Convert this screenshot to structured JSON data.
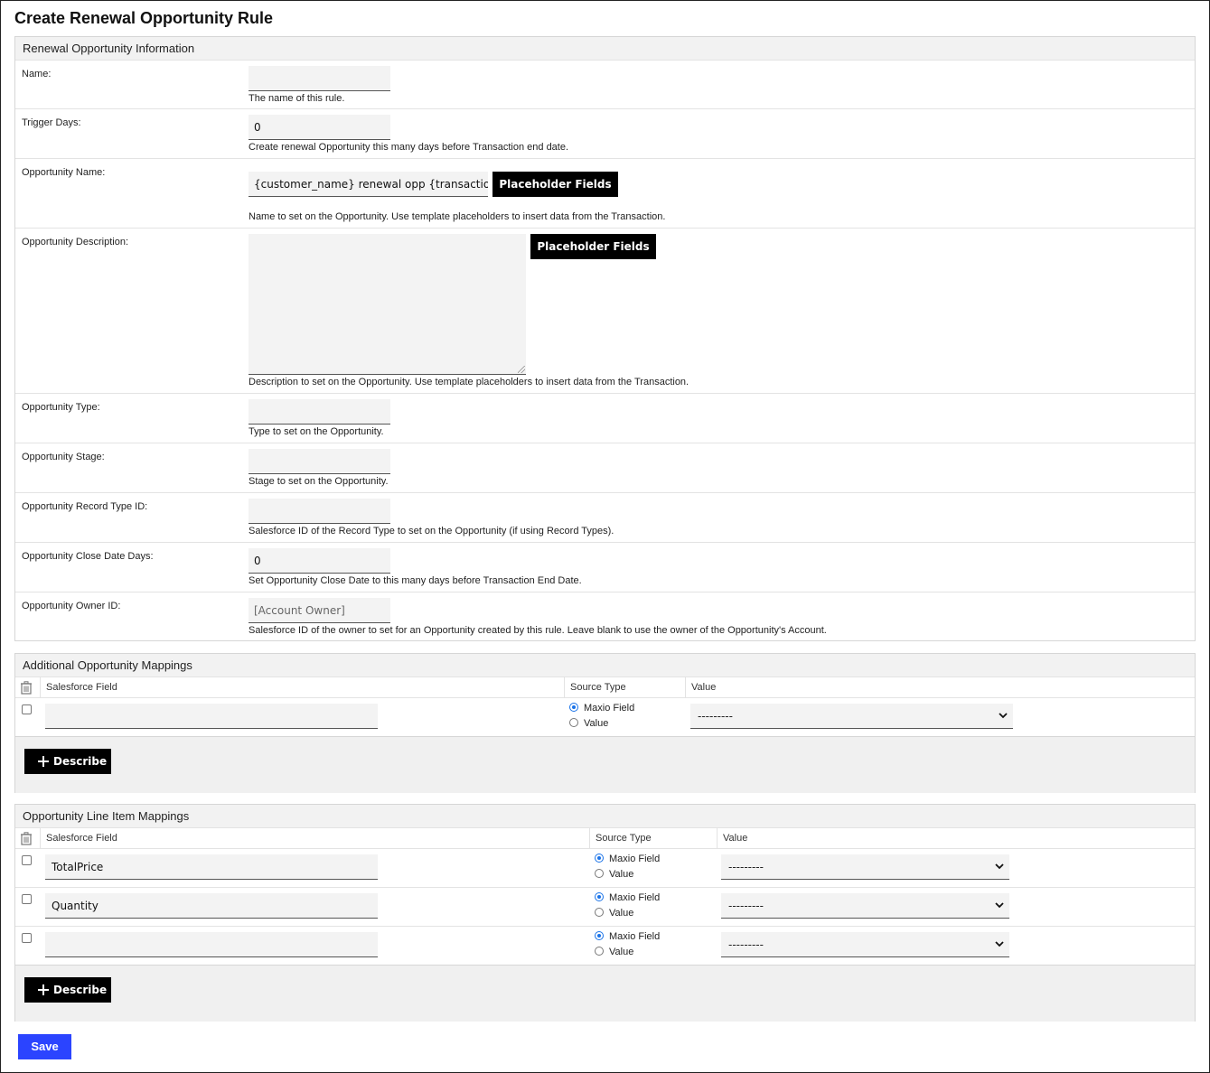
{
  "page": {
    "title": "Create Renewal Opportunity Rule"
  },
  "info": {
    "heading": "Renewal Opportunity Information",
    "fields": {
      "name": {
        "label": "Name:",
        "value": "",
        "help": "The name of this rule."
      },
      "trigger_days": {
        "label": "Trigger Days:",
        "value": "0",
        "help": "Create renewal Opportunity this many days before Transaction end date."
      },
      "opp_name": {
        "label": "Opportunity Name:",
        "value": "{customer_name} renewal opp {transaction",
        "button": "Placeholder Fields",
        "help": "Name to set on the Opportunity. Use template placeholders to insert data from the Transaction."
      },
      "opp_desc": {
        "label": "Opportunity Description:",
        "value": "",
        "button": "Placeholder Fields",
        "help": "Description to set on the Opportunity. Use template placeholders to insert data from the Transaction."
      },
      "opp_type": {
        "label": "Opportunity Type:",
        "value": "",
        "help": "Type to set on the Opportunity."
      },
      "opp_stage": {
        "label": "Opportunity Stage:",
        "value": "",
        "help": "Stage to set on the Opportunity."
      },
      "record_type": {
        "label": "Opportunity Record Type ID:",
        "value": "",
        "help": "Salesforce ID of the Record Type to set on the Opportunity (if using Record Types)."
      },
      "close_days": {
        "label": "Opportunity Close Date Days:",
        "value": "0",
        "help": "Set Opportunity Close Date to this many days before Transaction End Date."
      },
      "owner_id": {
        "label": "Opportunity Owner ID:",
        "placeholder": "[Account Owner]",
        "help": "Salesforce ID of the owner to set for an Opportunity created by this rule. Leave blank to use the owner of the Opportunity's Account."
      }
    }
  },
  "additional": {
    "heading": "Additional Opportunity Mappings",
    "columns": {
      "sf_field": "Salesforce Field",
      "source_type": "Source Type",
      "value": "Value"
    },
    "rows": [
      {
        "sf_field": "",
        "radio_maxio": "Maxio Field",
        "radio_value": "Value",
        "selected": "maxio",
        "select_value": "---------"
      }
    ],
    "describe_label": "Describe"
  },
  "line_items": {
    "heading": "Opportunity Line Item Mappings",
    "columns": {
      "sf_field": "Salesforce Field",
      "source_type": "Source Type",
      "value": "Value"
    },
    "rows": [
      {
        "sf_field": "TotalPrice",
        "radio_maxio": "Maxio Field",
        "radio_value": "Value",
        "selected": "maxio",
        "select_value": "---------"
      },
      {
        "sf_field": "Quantity",
        "radio_maxio": "Maxio Field",
        "radio_value": "Value",
        "selected": "maxio",
        "select_value": "---------"
      },
      {
        "sf_field": "",
        "radio_maxio": "Maxio Field",
        "radio_value": "Value",
        "selected": "maxio",
        "select_value": "---------"
      }
    ],
    "describe_label": "Describe"
  },
  "actions": {
    "save_label": "Save"
  },
  "colors": {
    "save_button": "#2b44ff",
    "radio_selected": "#1a73e8",
    "black_button": "#000000"
  }
}
